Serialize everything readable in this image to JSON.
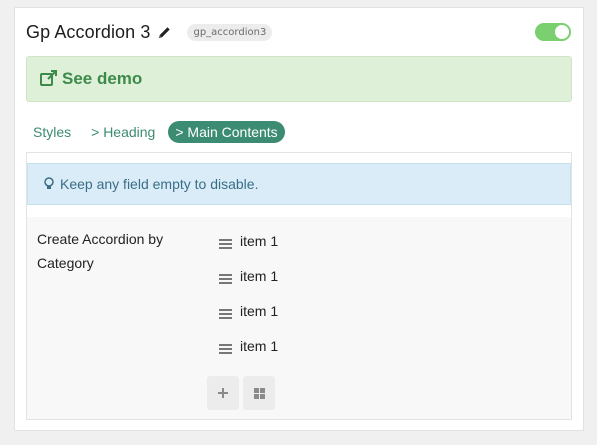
{
  "header": {
    "title": "Gp Accordion 3",
    "slug": "gp_accordion3",
    "toggle_on": true
  },
  "demo": {
    "label": "See demo"
  },
  "tabs": [
    {
      "label": "Styles",
      "active": false
    },
    {
      "label": "> Heading",
      "active": false
    },
    {
      "label": "> Main Contents",
      "active": true
    }
  ],
  "info": {
    "text": "Keep any field empty to disable."
  },
  "field": {
    "label": "Create Accordion by Category",
    "items": [
      "item 1",
      "item 1",
      "item 1",
      "item 1"
    ]
  },
  "icons": {
    "edit": "pencil-icon",
    "demo": "external-link-icon",
    "info": "lightbulb-icon",
    "handle": "drag-handle-icon",
    "add": "plus-icon",
    "grid": "grid-icon"
  },
  "colors": {
    "accent": "#3b8c72",
    "toggle": "#7ad06f",
    "demo_bg": "#dff0d8",
    "info_bg": "#d9ecf7"
  }
}
